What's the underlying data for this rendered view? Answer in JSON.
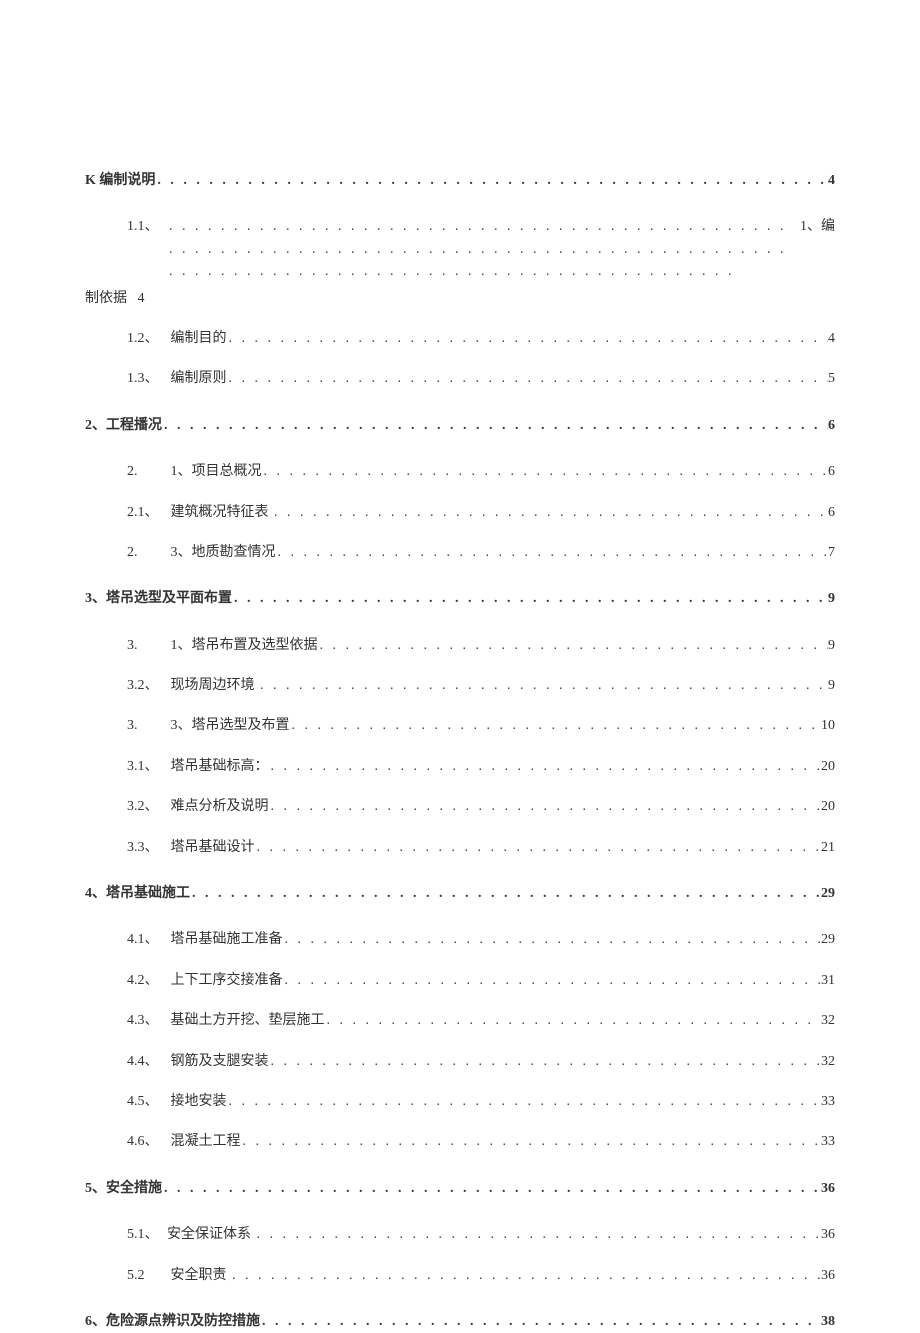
{
  "toc": {
    "s1": {
      "label": "K 编制说明",
      "page": "4"
    },
    "s1_1": {
      "num": "1.1、",
      "label": "",
      "tail": "1、编",
      "bottom_left": "制依据",
      "bottom_right": "4"
    },
    "s1_2": {
      "num": "1.2、",
      "label": "编制目的",
      "page": "4"
    },
    "s1_3": {
      "num": "1.3、",
      "label": "编制原则",
      "page": "5"
    },
    "s2": {
      "label": "2、工程播况",
      "page": "6"
    },
    "s2_1": {
      "num": "2.",
      "label": "1、项目总概况",
      "page": "6"
    },
    "s2_1b": {
      "num": "2.1、",
      "label": "建筑概况特征表",
      "page": "6"
    },
    "s2_3": {
      "num": "2.",
      "label": "3、地质勘查情况",
      "page": "7"
    },
    "s3": {
      "label": "3、塔吊选型及平面布置",
      "page": "9"
    },
    "s3_1": {
      "num": "3.",
      "label": "1、塔吊布置及选型依据",
      "page": "9"
    },
    "s3_2": {
      "num": "3.2、",
      "label": "现场周边环境",
      "page": "9"
    },
    "s3_3": {
      "num": "3.",
      "label": "3、塔吊选型及布置",
      "page": "10"
    },
    "s3_1b": {
      "num": "3.1、",
      "label": "塔吊基础标高：",
      "page": "20"
    },
    "s3_2b": {
      "num": "3.2、",
      "label": "难点分析及说明",
      "page": "20"
    },
    "s3_3b": {
      "num": "3.3、",
      "label": "塔吊基础设计",
      "page": "21"
    },
    "s4": {
      "label": "4、塔吊基础施工",
      "page": "29"
    },
    "s4_1": {
      "num": "4.1、",
      "label": "塔吊基础施工准备",
      "page": "29"
    },
    "s4_2": {
      "num": "4.2、",
      "label": "上下工序交接准备",
      "page": "31"
    },
    "s4_3": {
      "num": "4.3、",
      "label": "基础土方开挖、垫层施工",
      "page": "32"
    },
    "s4_4": {
      "num": "4.4、",
      "label": "钢筋及支腿安装",
      "page": "32"
    },
    "s4_5": {
      "num": "4.5、",
      "label": "接地安装",
      "page": "33"
    },
    "s4_6": {
      "num": "4.6、",
      "label": "混凝土工程",
      "page": "33"
    },
    "s5": {
      "label": "5、安全措施",
      "page": "36"
    },
    "s5_1": {
      "num": "5.1、",
      "label": "安全保证体系",
      "page": "36"
    },
    "s5_2": {
      "num": "5.2",
      "label": "安全职责",
      "page": "36"
    },
    "s6": {
      "label": "6、危险源点辨识及防控措施",
      "page": "38"
    }
  }
}
